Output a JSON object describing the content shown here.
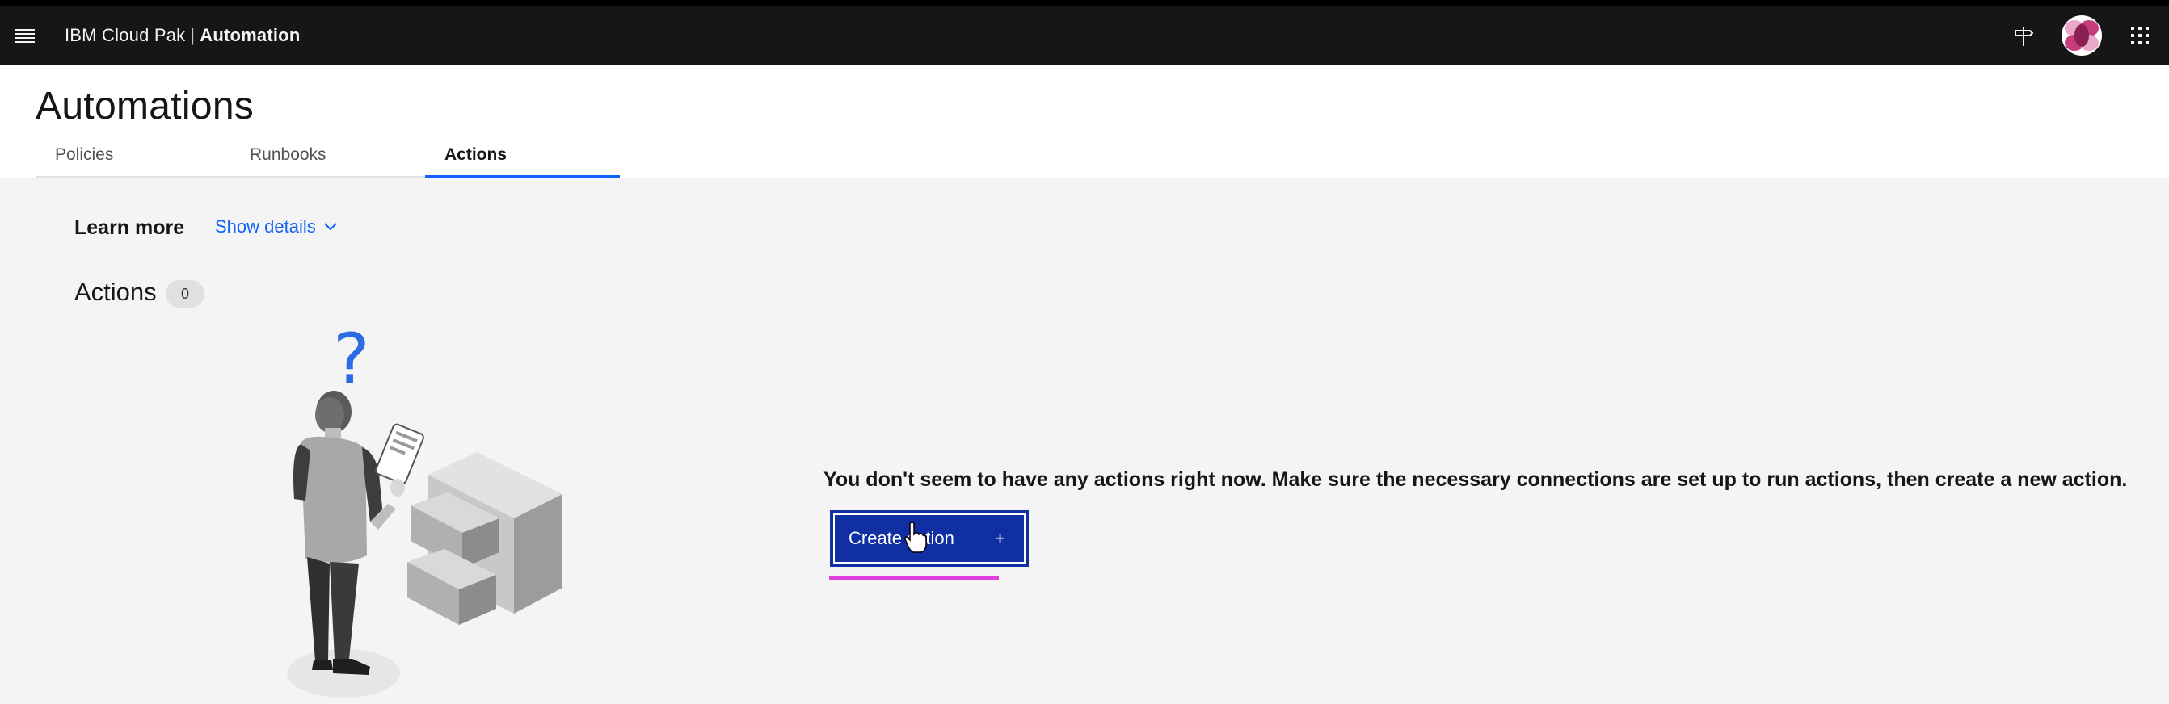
{
  "header": {
    "brand_prefix": "IBM Cloud Pak",
    "separator": "|",
    "product": "Automation",
    "icons": [
      "menu-icon",
      "signpost-icon",
      "avatar",
      "app-switcher-icon"
    ]
  },
  "page": {
    "title": "Automations",
    "tabs": [
      {
        "label": "Policies",
        "active": false
      },
      {
        "label": "Runbooks",
        "active": false
      },
      {
        "label": "Actions",
        "active": true
      }
    ]
  },
  "learn_more": {
    "label": "Learn more",
    "toggle_label": "Show details"
  },
  "section": {
    "title": "Actions",
    "count": "0"
  },
  "empty_state": {
    "message": "You don't seem to have any actions right now. Make sure the necessary connections are set up to run actions, then create a new action.",
    "button_label": "Create action",
    "button_icon": "+"
  },
  "colors": {
    "header_bg": "#161616",
    "link": "#0f62fe",
    "primary_button": "#0f2fa3",
    "page_bg": "#f4f4f4",
    "highlight_mark": "#e040e0"
  }
}
